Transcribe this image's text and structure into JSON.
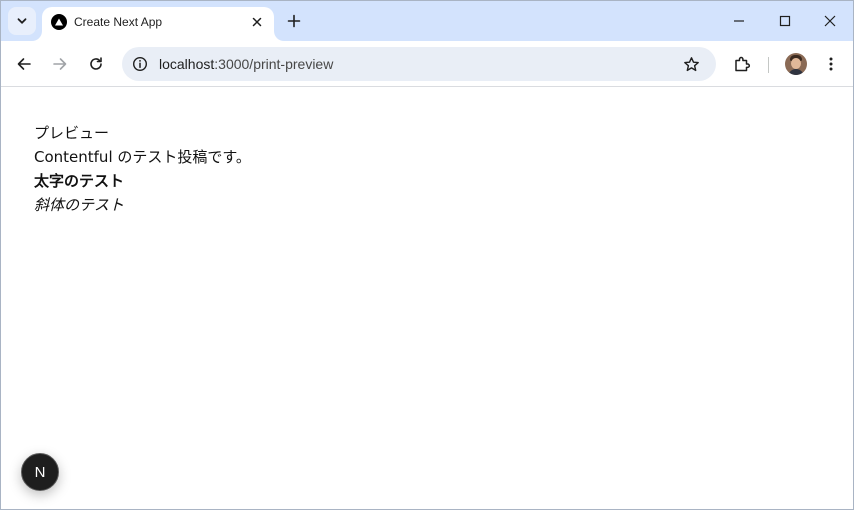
{
  "browser": {
    "tab": {
      "title": "Create Next App"
    },
    "address": {
      "host": "localhost",
      "path": ":3000/print-preview"
    }
  },
  "icons": {
    "tab_search": "chevron-down-icon",
    "favicon": "next-triangle-icon",
    "tab_close": "close-icon",
    "new_tab": "plus-icon",
    "minimize": "minimize-icon",
    "maximize": "maximize-icon",
    "close_window": "close-icon",
    "back": "arrow-left-icon",
    "forward": "arrow-right-icon",
    "reload": "reload-icon",
    "site_info": "info-icon",
    "bookmark": "star-icon",
    "extensions": "puzzle-icon",
    "menu": "kebab-menu-icon"
  },
  "page": {
    "heading": "プレビュー",
    "body": "Contentful のテスト投稿です。",
    "bold_text": "太字のテスト",
    "italic_text": "斜体のテスト"
  },
  "dev_badge": {
    "label": "N"
  }
}
